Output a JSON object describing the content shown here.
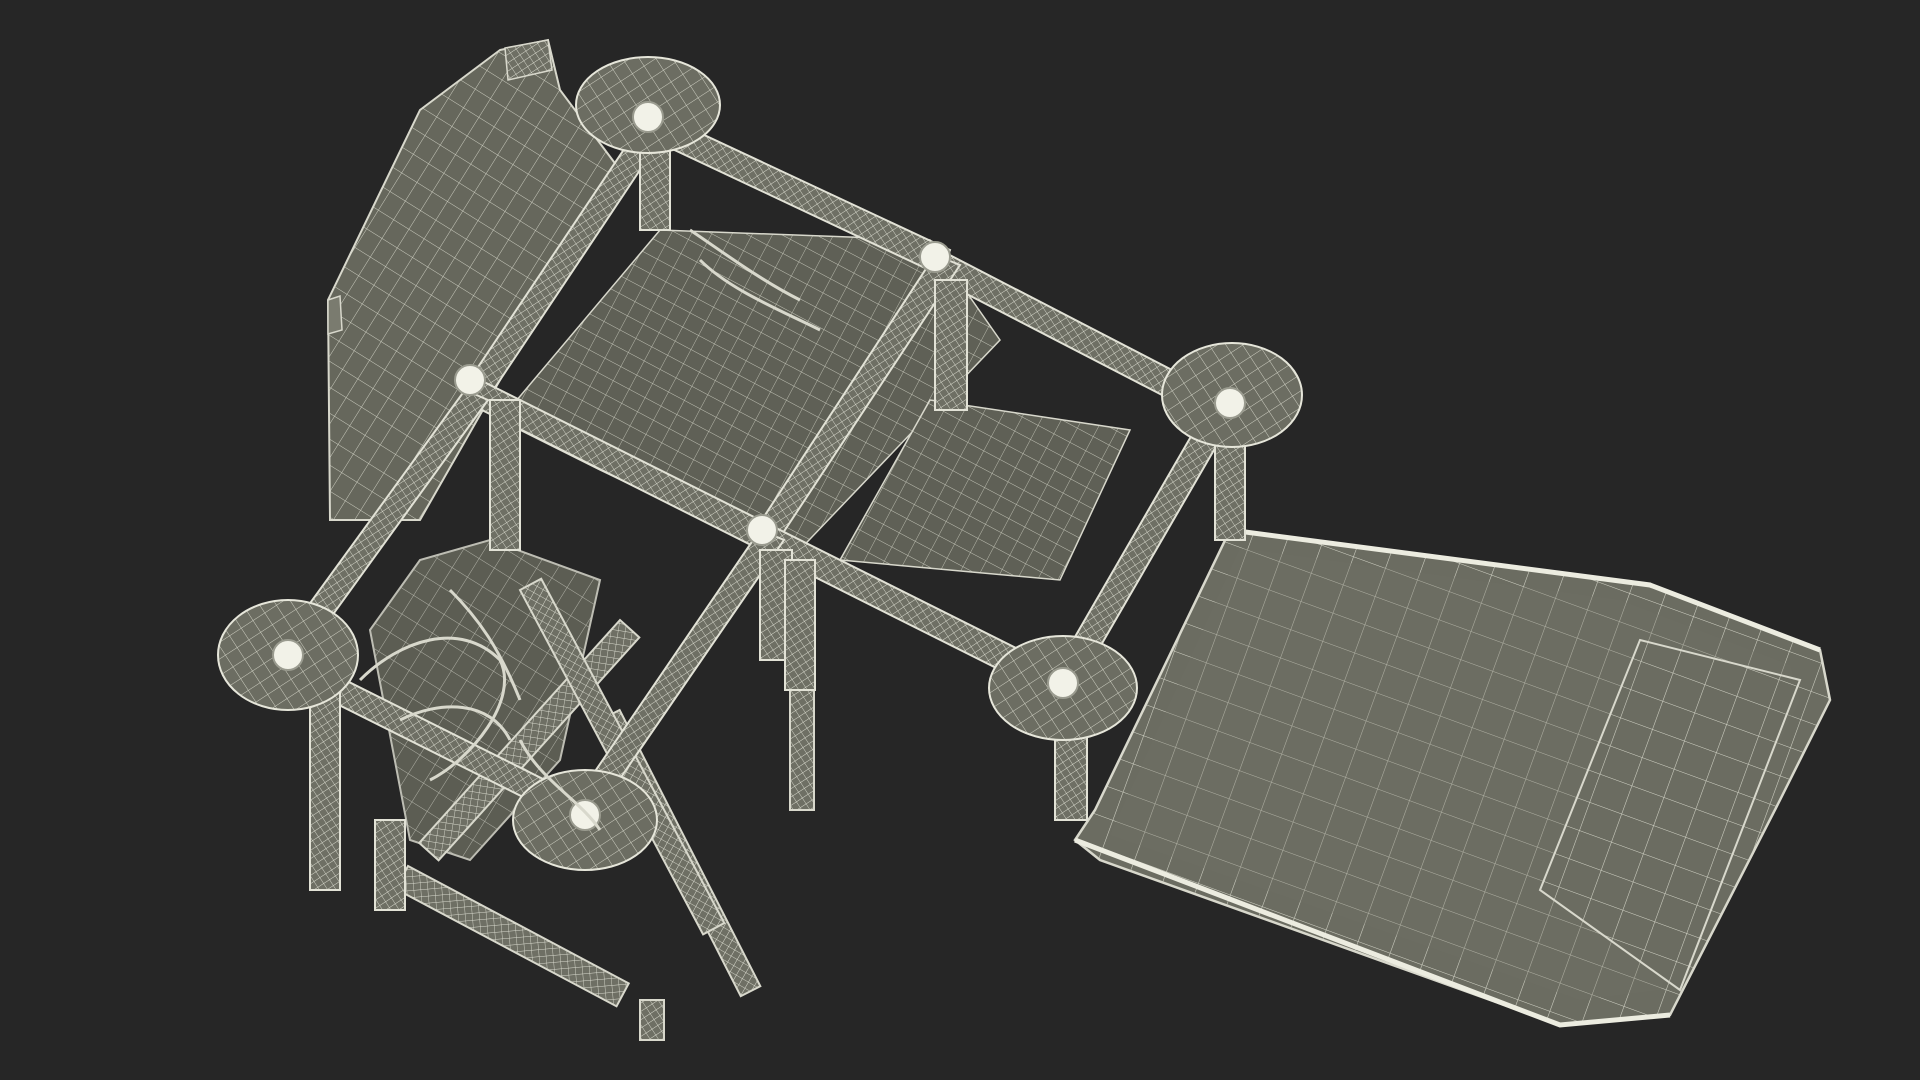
{
  "scene": {
    "description_visible_text": "",
    "colors": {
      "background": "#262626",
      "surface": "#6c6d62",
      "surface_dark": "#585a50",
      "surface_light": "#7a7b6f",
      "wire": "#d8d8cc",
      "wire_dim": "#b9baae"
    }
  }
}
